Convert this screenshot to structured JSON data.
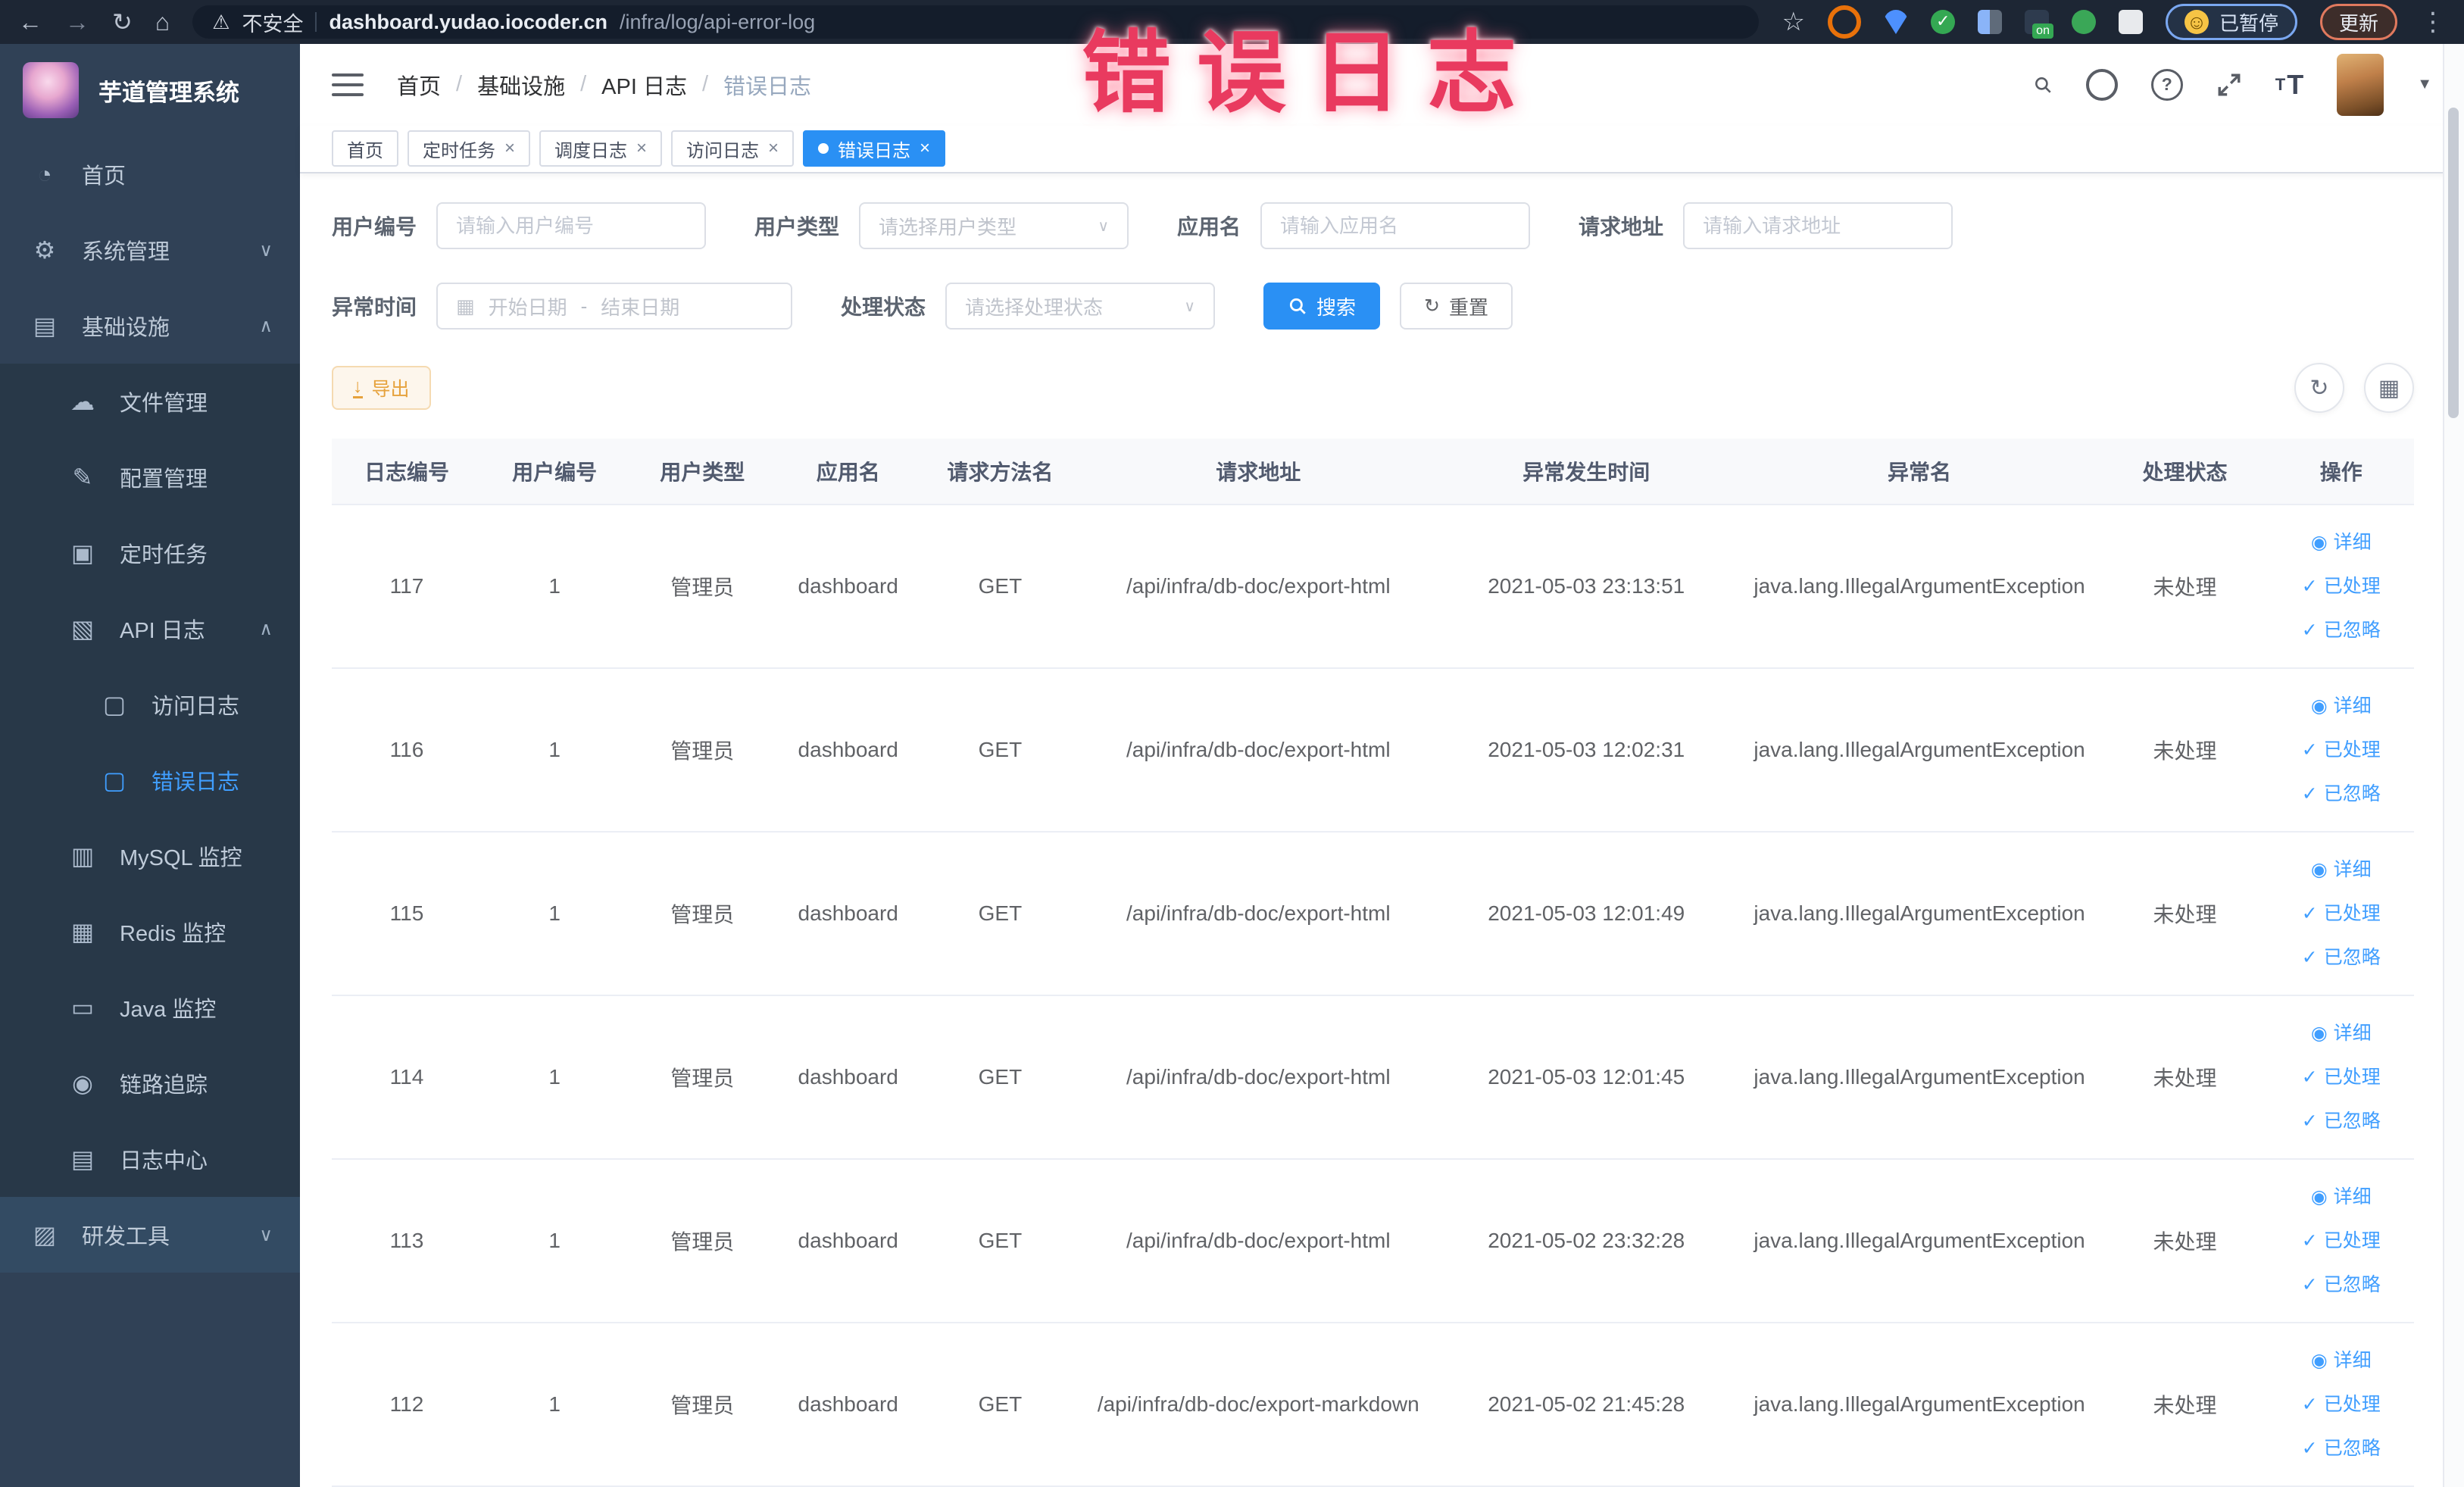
{
  "colors": {
    "accent": "#409eff",
    "active_tab": "#2a90f4",
    "warning": "#e6a23c",
    "watermark_red": "#e93a5f",
    "sidebar_bg": "#304156"
  },
  "watermark": "错误日志",
  "browser": {
    "security_label": "不安全",
    "url_host": "dashboard.yudao.iocoder.cn",
    "url_path": "/infra/log/api-error-log",
    "paused_label": "已暂停",
    "update_label": "更新"
  },
  "sidebar": {
    "app_title": "芋道管理系统",
    "items": {
      "home": "首页",
      "system": "系统管理",
      "infra": "基础设施",
      "file": "文件管理",
      "config": "配置管理",
      "job": "定时任务",
      "api_log": "API 日志",
      "access_log": "访问日志",
      "error_log": "错误日志",
      "mysql": "MySQL 监控",
      "redis": "Redis 监控",
      "java": "Java 监控",
      "trace": "链路追踪",
      "log_center": "日志中心",
      "dev_tools": "研发工具"
    }
  },
  "breadcrumb": [
    "首页",
    "基础设施",
    "API 日志",
    "错误日志"
  ],
  "tabs": [
    {
      "label": "首页",
      "active": false,
      "closable": false
    },
    {
      "label": "定时任务",
      "active": false,
      "closable": true
    },
    {
      "label": "调度日志",
      "active": false,
      "closable": true
    },
    {
      "label": "访问日志",
      "active": false,
      "closable": true
    },
    {
      "label": "错误日志",
      "active": true,
      "closable": true
    }
  ],
  "filters": {
    "user_id": {
      "label": "用户编号",
      "placeholder": "请输入用户编号"
    },
    "user_type": {
      "label": "用户类型",
      "placeholder": "请选择用户类型"
    },
    "app_name": {
      "label": "应用名",
      "placeholder": "请输入应用名"
    },
    "request_url": {
      "label": "请求地址",
      "placeholder": "请输入请求地址"
    },
    "exception_time": {
      "label": "异常时间",
      "start_placeholder": "开始日期",
      "separator": "-",
      "end_placeholder": "结束日期"
    },
    "process_status": {
      "label": "处理状态",
      "placeholder": "请选择处理状态"
    },
    "search_label": "搜索",
    "reset_label": "重置"
  },
  "toolbar": {
    "export_label": "导出"
  },
  "table": {
    "columns": [
      "日志编号",
      "用户编号",
      "用户类型",
      "应用名",
      "请求方法名",
      "请求地址",
      "异常发生时间",
      "异常名",
      "处理状态",
      "操作"
    ],
    "actions": [
      "详细",
      "已处理",
      "已忽略"
    ],
    "rows": [
      {
        "id": "117",
        "user_id": "1",
        "user_type": "管理员",
        "app": "dashboard",
        "method": "GET",
        "url": "/api/infra/db-doc/export-html",
        "time": "2021-05-03 23:13:51",
        "exception": "java.lang.IllegalArgumentException",
        "status": "未处理"
      },
      {
        "id": "116",
        "user_id": "1",
        "user_type": "管理员",
        "app": "dashboard",
        "method": "GET",
        "url": "/api/infra/db-doc/export-html",
        "time": "2021-05-03 12:02:31",
        "exception": "java.lang.IllegalArgumentException",
        "status": "未处理"
      },
      {
        "id": "115",
        "user_id": "1",
        "user_type": "管理员",
        "app": "dashboard",
        "method": "GET",
        "url": "/api/infra/db-doc/export-html",
        "time": "2021-05-03 12:01:49",
        "exception": "java.lang.IllegalArgumentException",
        "status": "未处理"
      },
      {
        "id": "114",
        "user_id": "1",
        "user_type": "管理员",
        "app": "dashboard",
        "method": "GET",
        "url": "/api/infra/db-doc/export-html",
        "time": "2021-05-03 12:01:45",
        "exception": "java.lang.IllegalArgumentException",
        "status": "未处理"
      },
      {
        "id": "113",
        "user_id": "1",
        "user_type": "管理员",
        "app": "dashboard",
        "method": "GET",
        "url": "/api/infra/db-doc/export-html",
        "time": "2021-05-02 23:32:28",
        "exception": "java.lang.IllegalArgumentException",
        "status": "未处理"
      },
      {
        "id": "112",
        "user_id": "1",
        "user_type": "管理员",
        "app": "dashboard",
        "method": "GET",
        "url": "/api/infra/db-doc/export-markdown",
        "time": "2021-05-02 21:45:28",
        "exception": "java.lang.IllegalArgumentException",
        "status": "未处理"
      }
    ]
  }
}
